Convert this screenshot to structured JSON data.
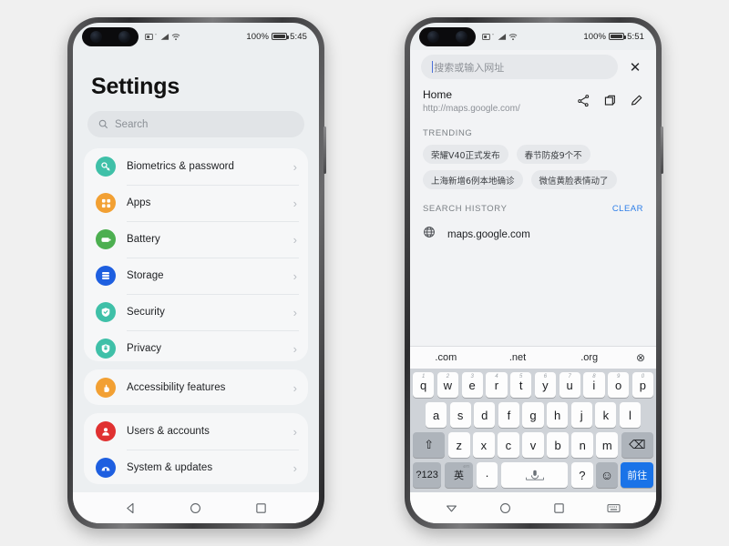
{
  "background_color": "#f0f0f0",
  "left_phone": {
    "status_bar": {
      "battery_percent": "100%",
      "time": "5:45",
      "icons": [
        "sim-card-icon",
        "signal-bars-icon",
        "wifi-icon"
      ]
    },
    "page_title": "Settings",
    "search": {
      "placeholder": "Search",
      "icon": "search-icon"
    },
    "groups": [
      {
        "items": [
          {
            "label": "Biometrics & password",
            "icon": "key-icon",
            "color": "#3fc0a8"
          },
          {
            "label": "Apps",
            "icon": "apps-grid-icon",
            "color": "#f2a033"
          },
          {
            "label": "Battery",
            "icon": "battery-icon",
            "color": "#4caf50"
          },
          {
            "label": "Storage",
            "icon": "storage-stack-icon",
            "color": "#1e5fe0"
          },
          {
            "label": "Security",
            "icon": "shield-check-icon",
            "color": "#3fc0a8"
          },
          {
            "label": "Privacy",
            "icon": "shield-lock-icon",
            "color": "#3fc0a8"
          }
        ]
      },
      {
        "items": [
          {
            "label": "Accessibility features",
            "icon": "hand-icon",
            "color": "#f2a033"
          }
        ]
      },
      {
        "items": [
          {
            "label": "Users & accounts",
            "icon": "user-icon",
            "color": "#e03131"
          },
          {
            "label": "System & updates",
            "icon": "system-update-icon",
            "color": "#1e5fe0"
          }
        ]
      }
    ],
    "nav_bar": [
      "back-triangle-icon",
      "home-circle-icon",
      "recents-square-icon"
    ]
  },
  "right_phone": {
    "status_bar": {
      "battery_percent": "100%",
      "time": "5:51",
      "icons": [
        "sim-card-icon",
        "signal-bars-icon",
        "wifi-icon"
      ]
    },
    "address_bar": {
      "placeholder": "搜索或输入网址",
      "value": "",
      "close_label": "✕"
    },
    "home": {
      "title": "Home",
      "url": "http://maps.google.com/",
      "actions": [
        "share-icon",
        "tabs-cube-icon",
        "edit-pencil-icon"
      ]
    },
    "trending": {
      "heading": "TRENDING",
      "chips": [
        "荣耀V40正式发布",
        "春节防疫9个不",
        "上海新增6例本地确诊",
        "微信黄脸表情动了"
      ]
    },
    "search_history": {
      "heading": "SEARCH HISTORY",
      "clear_label": "CLEAR",
      "items": [
        {
          "text": "maps.google.com",
          "icon": "globe-icon"
        }
      ]
    },
    "suggestion_bar": {
      "items": [
        ".com",
        ".net",
        ".org"
      ],
      "delete_label": "⊗"
    },
    "keyboard": {
      "row1": [
        {
          "key": "q",
          "sup": "1"
        },
        {
          "key": "w",
          "sup": "2"
        },
        {
          "key": "e",
          "sup": "3"
        },
        {
          "key": "r",
          "sup": "4"
        },
        {
          "key": "t",
          "sup": "5"
        },
        {
          "key": "y",
          "sup": "6"
        },
        {
          "key": "u",
          "sup": "7"
        },
        {
          "key": "i",
          "sup": "8"
        },
        {
          "key": "o",
          "sup": "9"
        },
        {
          "key": "p",
          "sup": "0"
        }
      ],
      "row2": [
        {
          "key": "a",
          "sup": ""
        },
        {
          "key": "s",
          "sup": ""
        },
        {
          "key": "d",
          "sup": ""
        },
        {
          "key": "f",
          "sup": ""
        },
        {
          "key": "g",
          "sup": ""
        },
        {
          "key": "h",
          "sup": ""
        },
        {
          "key": "j",
          "sup": ""
        },
        {
          "key": "k",
          "sup": ""
        },
        {
          "key": "l",
          "sup": ""
        }
      ],
      "row3": {
        "shift": "⇧",
        "keys": [
          {
            "key": "z"
          },
          {
            "key": "x"
          },
          {
            "key": "c"
          },
          {
            "key": "v"
          },
          {
            "key": "b"
          },
          {
            "key": "n"
          },
          {
            "key": "m"
          }
        ],
        "backspace": "⌫"
      },
      "row4": {
        "symbols": "?123",
        "lang": "英",
        "period": "·",
        "space": "",
        "question": "?",
        "emoji": "☺",
        "go": "前往"
      }
    },
    "nav_bar": [
      "hide-keyboard-triangle-icon",
      "home-circle-icon",
      "recents-square-icon",
      "keyboard-icon"
    ]
  }
}
